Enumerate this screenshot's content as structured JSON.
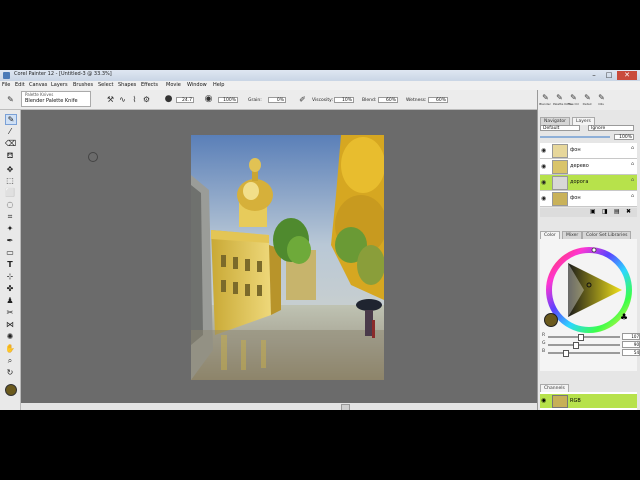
{
  "window": {
    "title": "Corel Painter 12 - [Untitled-3 @ 33.3%]",
    "controls": [
      "–",
      "□",
      "✕"
    ]
  },
  "menu": [
    "File",
    "Edit",
    "Canvas",
    "Layers",
    "Brushes",
    "Select",
    "Shapes",
    "Effects",
    "Movie",
    "Window",
    "Help"
  ],
  "property_bar": {
    "variant_category": "Palette Knives",
    "variant_name": "Blender Palette Knife",
    "size_value": "24.7",
    "opacity_value": "100%",
    "grain_label": "Grain:",
    "grain_value": "0%",
    "viscosity_label": "Viscosity:",
    "viscosity_value": "10%",
    "blend_label": "Blend:",
    "blend_value": "60%",
    "wetness_label": "Wetness:",
    "wetness_value": "60%"
  },
  "recent_brushes": [
    "Blender",
    "Palette Knife",
    "Fine Oil",
    "Detail",
    "Oils"
  ],
  "layers_panel": {
    "tabs": [
      "Navigator",
      "Layers"
    ],
    "active_tab": "Layers",
    "composite_method": "Default",
    "composite_depth": "Ignore",
    "opacity": "100%",
    "layers": [
      {
        "name": "фон",
        "selected": false
      },
      {
        "name": "дерево",
        "selected": false
      },
      {
        "name": "дорога",
        "selected": true
      },
      {
        "name": "фон",
        "selected": false
      }
    ]
  },
  "color_panel": {
    "tabs": [
      "Color",
      "Mixer",
      "Color Set Libraries"
    ],
    "active_tab": "Color",
    "main_color": "#6b5a1e",
    "r_value": "107",
    "g_value": "90",
    "b_value": "54"
  },
  "channels_panel": {
    "tab": "Channels",
    "channel_name": "RGB"
  },
  "colors": {
    "selected_layer": "#b7e24b",
    "accent": "#4a7ab8"
  }
}
